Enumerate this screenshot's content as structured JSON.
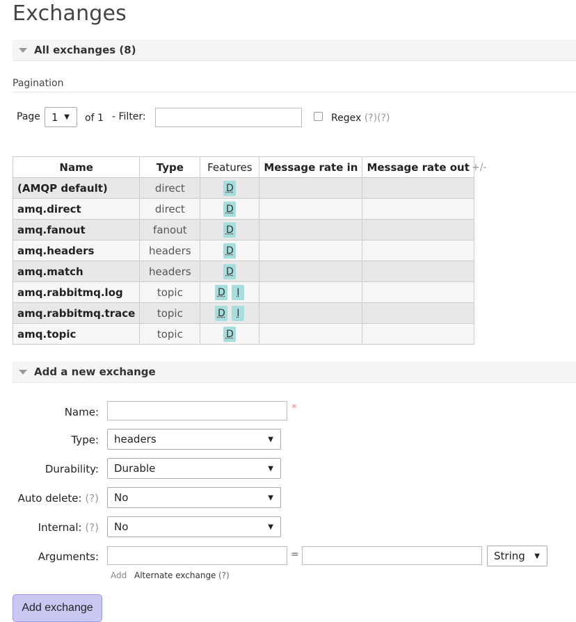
{
  "page_title": "Exchanges",
  "all_exchanges": {
    "title": "All exchanges (8)"
  },
  "pagination": {
    "label": "Pagination",
    "page_label": "Page",
    "page_value": "1",
    "of_label": "of 1",
    "filter_label": "- Filter:",
    "filter_value": "",
    "regex_label": "Regex",
    "regex_help": "(?)(?)"
  },
  "table": {
    "headers": [
      "Name",
      "Type",
      "Features",
      "Message rate in",
      "Message rate out"
    ],
    "toggle_columns": "+/-",
    "rows": [
      {
        "name": "(AMQP default)",
        "type": "direct",
        "features": [
          "D"
        ],
        "rate_in": "",
        "rate_out": ""
      },
      {
        "name": "amq.direct",
        "type": "direct",
        "features": [
          "D"
        ],
        "rate_in": "",
        "rate_out": ""
      },
      {
        "name": "amq.fanout",
        "type": "fanout",
        "features": [
          "D"
        ],
        "rate_in": "",
        "rate_out": ""
      },
      {
        "name": "amq.headers",
        "type": "headers",
        "features": [
          "D"
        ],
        "rate_in": "",
        "rate_out": ""
      },
      {
        "name": "amq.match",
        "type": "headers",
        "features": [
          "D"
        ],
        "rate_in": "",
        "rate_out": ""
      },
      {
        "name": "amq.rabbitmq.log",
        "type": "topic",
        "features": [
          "D",
          "I"
        ],
        "rate_in": "",
        "rate_out": ""
      },
      {
        "name": "amq.rabbitmq.trace",
        "type": "topic",
        "features": [
          "D",
          "I"
        ],
        "rate_in": "",
        "rate_out": ""
      },
      {
        "name": "amq.topic",
        "type": "topic",
        "features": [
          "D"
        ],
        "rate_in": "",
        "rate_out": ""
      }
    ]
  },
  "add_exchange": {
    "title": "Add a new exchange",
    "name_label": "Name:",
    "name_value": "",
    "required_mark": "*",
    "type_label": "Type:",
    "type_value": "headers",
    "durability_label": "Durability:",
    "durability_value": "Durable",
    "auto_delete_label": "Auto delete:",
    "auto_delete_help": "(?)",
    "auto_delete_value": "No",
    "internal_label": "Internal:",
    "internal_help": "(?)",
    "internal_value": "No",
    "arguments_label": "Arguments:",
    "arg_key": "",
    "arg_equals": "=",
    "arg_value": "",
    "arg_type": "String",
    "add_link": "Add",
    "alternate_exchange_link": "Alternate exchange",
    "alternate_exchange_help": "(?)",
    "submit_label": "Add exchange"
  },
  "colors": {
    "feature_badge": "#a6dede",
    "button_bg": "#c8c8f3",
    "row_odd": "#e8e8e8",
    "row_even": "#f7f7f7"
  }
}
